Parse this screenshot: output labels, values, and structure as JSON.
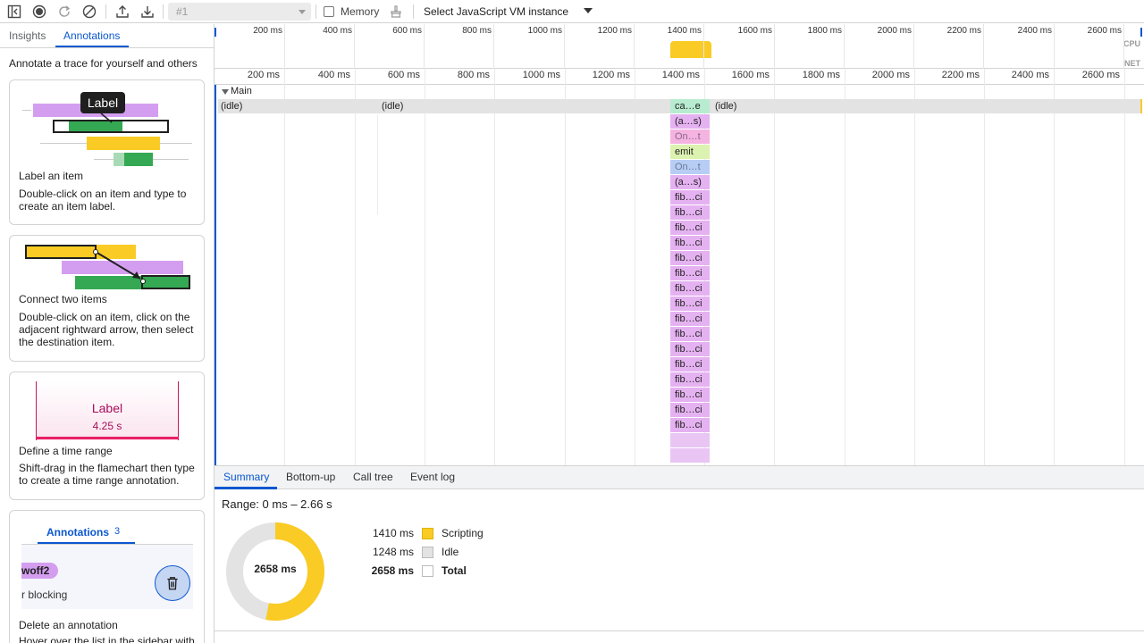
{
  "toolbar": {
    "trace_select": "#1",
    "memory_label": "Memory",
    "vm_select": "Select JavaScript VM instance"
  },
  "sidebar": {
    "tabs": [
      "Insights",
      "Annotations"
    ],
    "active_tab": "Annotations",
    "intro": "Annotate a trace for yourself and others",
    "cards": [
      {
        "illustration_label": "Label",
        "title": "Label an item",
        "desc": "Double-click on an item and type to create an item label."
      },
      {
        "title": "Connect two items",
        "desc": "Double-click on an item, click on the adjacent rightward arrow, then select the destination item."
      },
      {
        "illustration_label": "Label",
        "illustration_time": "4.25 s",
        "title": "Define a time range",
        "desc": "Shift-drag in the flamechart then type to create a time range annotation."
      },
      {
        "illustration_tab": "Annotations",
        "illustration_count": "3",
        "illustration_chip": "woff2",
        "illustration_text": "r blocking",
        "title": "Delete an annotation",
        "desc": "Hover over the list in the sidebar with"
      }
    ]
  },
  "overview": {
    "ticks": [
      "200 ms",
      "400 ms",
      "600 ms",
      "800 ms",
      "1000 ms",
      "1200 ms",
      "1400 ms",
      "1600 ms",
      "1800 ms",
      "2000 ms",
      "2200 ms",
      "2400 ms",
      "2600 ms"
    ],
    "cpu_label": "CPU",
    "net_label": "NET"
  },
  "ruler": {
    "ticks": [
      "200 ms",
      "400 ms",
      "600 ms",
      "800 ms",
      "1000 ms",
      "1200 ms",
      "1400 ms",
      "1600 ms",
      "1800 ms",
      "2000 ms",
      "2200 ms",
      "2400 ms",
      "2600 ms"
    ]
  },
  "main_track": {
    "label": "Main",
    "idle": [
      "(idle)",
      "(idle)",
      "(idle)"
    ],
    "stack": [
      "ca…e",
      "(a…s)",
      "On…t",
      "emit",
      "On…t",
      "(a…s)",
      "fib…ci",
      "fib…ci",
      "fib…ci",
      "fib…ci",
      "fib…ci",
      "fib…ci",
      "fib…ci",
      "fib…ci",
      "fib…ci",
      "fib…ci",
      "fib…ci",
      "fib…ci",
      "fib…ci",
      "fib…ci",
      "fib…ci",
      "fib…ci"
    ]
  },
  "bottom": {
    "tabs": [
      "Summary",
      "Bottom-up",
      "Call tree",
      "Event log"
    ],
    "active_tab": "Summary",
    "range": "Range: 0 ms – 2.66 s",
    "total_center": "2658 ms",
    "legend": [
      {
        "value": "1410 ms",
        "name": "Scripting",
        "color": "#f9cb24"
      },
      {
        "value": "1248 ms",
        "name": "Idle",
        "color": "#e3e3e3"
      },
      {
        "value": "2658 ms",
        "name": "Total",
        "color": "#ffffff"
      }
    ],
    "scripting_fraction": 0.5305
  },
  "colors": {
    "accent": "#0b57d0",
    "scripting": "#f9cb24",
    "idle": "#e3e3e3",
    "flame_purple": "#e5b2f1",
    "flame_green": "#b8ecd0"
  }
}
